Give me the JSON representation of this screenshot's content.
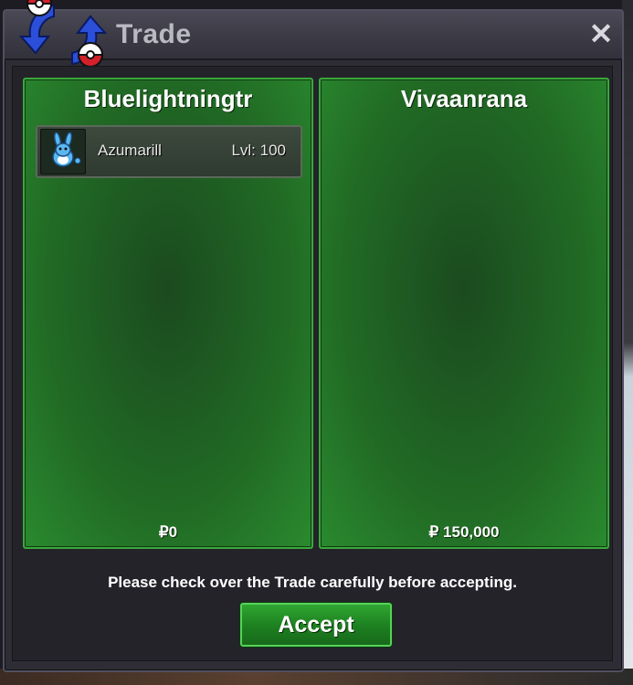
{
  "window": {
    "title": "Trade",
    "close_glyph": "✕",
    "logo_icon": "trade-pokeball-arrows-icon"
  },
  "panels": [
    {
      "player": "Bluelightningtr",
      "money": "₽0",
      "items": [
        {
          "icon": "azumarill-sprite-icon",
          "name": "Azumarill",
          "level": "Lvl: 100"
        }
      ]
    },
    {
      "player": "Vivaanrana",
      "money": "₽ 150,000",
      "items": []
    }
  ],
  "notice": "Please check over the Trade carefully before accepting.",
  "accept_label": "Accept",
  "colors": {
    "panel_green": "#216a25",
    "panel_border": "#3aa83c",
    "window_bg": "#2e2d35",
    "pokeball_red": "#d4202a",
    "arrow_blue": "#2b4fd8"
  }
}
